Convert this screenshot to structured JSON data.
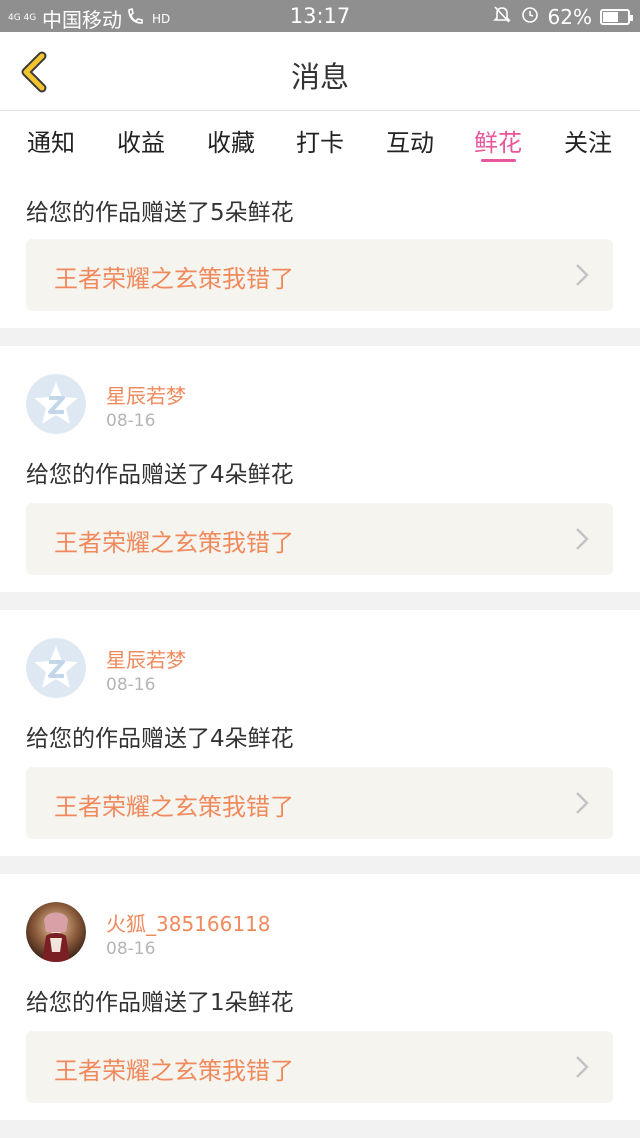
{
  "status_bar": {
    "signal_text": "4G 4G",
    "carrier": "中国移动",
    "hd": "HD",
    "time": "13:17",
    "battery_percent_text": "62%",
    "battery_level": 0.62
  },
  "header": {
    "back_icon": "chevron-left-icon",
    "title": "消息"
  },
  "tabs": [
    {
      "label": "通知",
      "active": false
    },
    {
      "label": "收益",
      "active": false
    },
    {
      "label": "收藏",
      "active": false
    },
    {
      "label": "打卡",
      "active": false
    },
    {
      "label": "互动",
      "active": false
    },
    {
      "label": "鲜花",
      "active": true
    },
    {
      "label": "关注",
      "active": false
    }
  ],
  "colors": {
    "accent": "#e8569b",
    "username": "#f08a5d",
    "work_title": "#f08a5d"
  },
  "items": [
    {
      "message": "给您的作品赠送了5朵鲜花",
      "work_title": "王者荣耀之玄策我错了"
    },
    {
      "username": "星辰若梦",
      "date": "08-16",
      "avatar": "qq-default-avatar",
      "message": "给您的作品赠送了4朵鲜花",
      "work_title": "王者荣耀之玄策我错了"
    },
    {
      "username": "星辰若梦",
      "date": "08-16",
      "avatar": "qq-default-avatar",
      "message": "给您的作品赠送了4朵鲜花",
      "work_title": "王者荣耀之玄策我错了"
    },
    {
      "username": "火狐_385166118",
      "date": "08-16",
      "avatar": "user-photo-avatar",
      "message": "给您的作品赠送了1朵鲜花",
      "work_title": "王者荣耀之玄策我错了"
    }
  ]
}
